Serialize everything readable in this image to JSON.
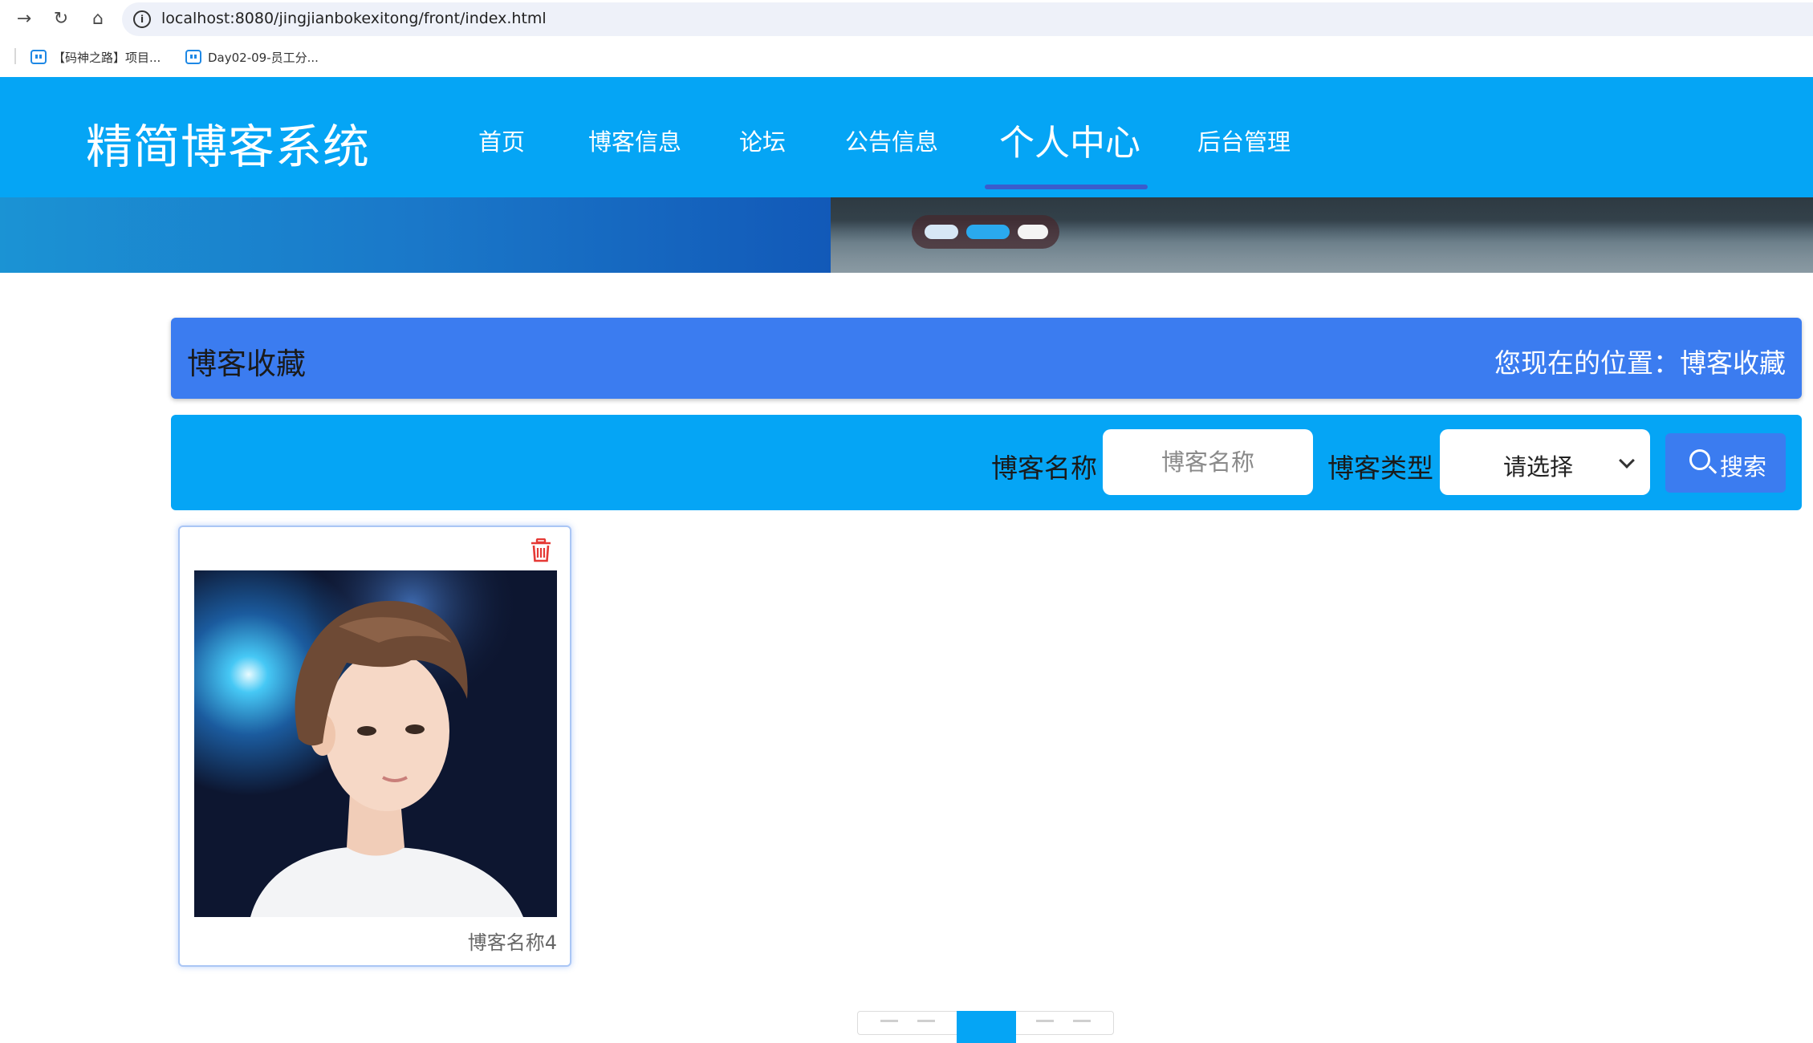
{
  "browser": {
    "url": "localhost:8080/jingjianbokexitong/front/index.html",
    "bookmarks": [
      {
        "label": "【码神之路】项目..."
      },
      {
        "label": "Day02-09-员工分..."
      }
    ]
  },
  "header": {
    "logo": "精简博客系统",
    "menu": [
      {
        "label": "首页"
      },
      {
        "label": "博客信息"
      },
      {
        "label": "论坛"
      },
      {
        "label": "公告信息"
      },
      {
        "label": "个人中心"
      },
      {
        "label": "后台管理"
      }
    ],
    "active_menu": "个人中心"
  },
  "page": {
    "title": "博客收藏",
    "location": "您现在的位置：博客收藏"
  },
  "search": {
    "name_label": "博客名称",
    "name_placeholder": "博客名称",
    "type_label": "博客类型",
    "type_selected": "请选择",
    "button_label": "搜索"
  },
  "cards": [
    {
      "title": "博客名称4"
    }
  ],
  "colors": {
    "header": "#05a5f5",
    "accent": "#3b7cf0",
    "danger": "#e53935"
  }
}
